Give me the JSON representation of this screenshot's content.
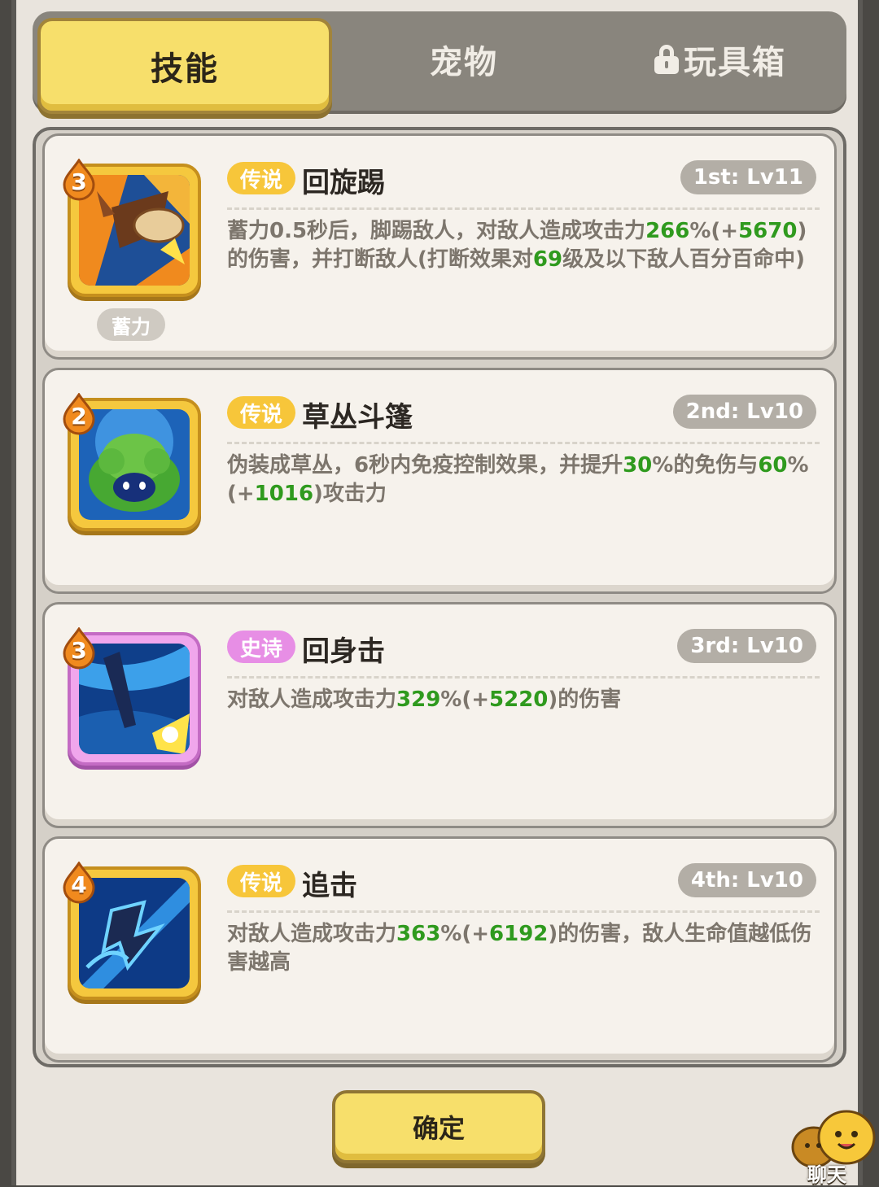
{
  "tabs": {
    "skills": "技能",
    "pets": "宠物",
    "toybox": "玩具箱"
  },
  "skills": [
    {
      "level_num": "3",
      "rarity": "传说",
      "name": "回旋踢",
      "slot": "1st: Lv11",
      "desc": [
        {
          "t": "蓄力0.5秒后，脚踢敌人，对敌人造成攻击力",
          "g": false
        },
        {
          "t": "266",
          "g": true
        },
        {
          "t": "%(+",
          "g": false
        },
        {
          "t": "5670",
          "g": true
        },
        {
          "t": ")的伤害，并打断敌人(打断效果对",
          "g": false
        },
        {
          "t": "69",
          "g": true
        },
        {
          "t": "级及以下敌人百分百命中)",
          "g": false
        }
      ],
      "tag": "蓄力",
      "icon": "kick-icon",
      "frame": "legend"
    },
    {
      "level_num": "2",
      "rarity": "传说",
      "name": "草丛斗篷",
      "slot": "2nd: Lv10",
      "desc": [
        {
          "t": "伪装成草丛，6秒内免疫控制效果，并提升",
          "g": false
        },
        {
          "t": "30",
          "g": true
        },
        {
          "t": "%的免伤与",
          "g": false
        },
        {
          "t": "60",
          "g": true
        },
        {
          "t": "%(+",
          "g": false
        },
        {
          "t": "1016",
          "g": true
        },
        {
          "t": ")攻击力",
          "g": false
        }
      ],
      "tag": "",
      "icon": "bush-icon",
      "frame": "legend"
    },
    {
      "level_num": "3",
      "rarity": "史诗",
      "name": "回身击",
      "slot": "3rd: Lv10",
      "desc": [
        {
          "t": "对敌人造成攻击力",
          "g": false
        },
        {
          "t": "329",
          "g": true
        },
        {
          "t": "%(+",
          "g": false
        },
        {
          "t": "5220",
          "g": true
        },
        {
          "t": ")的伤害",
          "g": false
        }
      ],
      "tag": "",
      "icon": "spin-strike-icon",
      "frame": "epic"
    },
    {
      "level_num": "4",
      "rarity": "传说",
      "name": "追击",
      "slot": "4th: Lv10",
      "desc": [
        {
          "t": "对敌人造成攻击力",
          "g": false
        },
        {
          "t": "363",
          "g": true
        },
        {
          "t": "%(+",
          "g": false
        },
        {
          "t": "6192",
          "g": true
        },
        {
          "t": ")的伤害，敌人生命值越低伤害越高",
          "g": false
        }
      ],
      "tag": "",
      "icon": "pursuit-icon",
      "frame": "legend"
    }
  ],
  "confirm_label": "确定",
  "chat_label": "聊天"
}
